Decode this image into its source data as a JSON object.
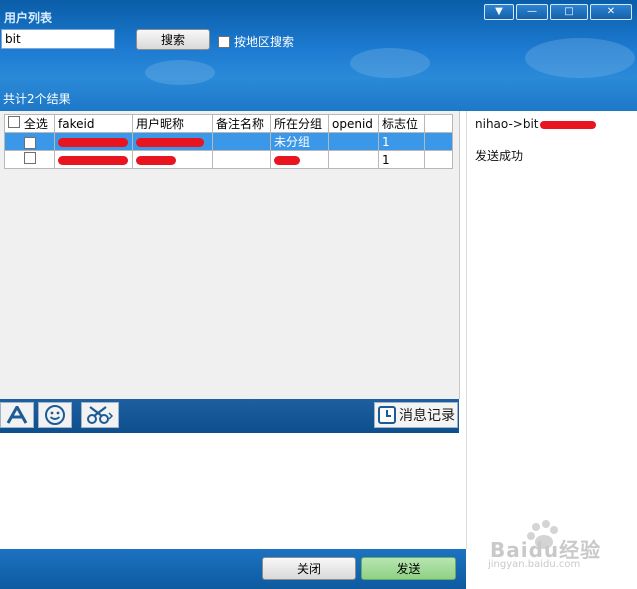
{
  "window": {
    "title": "用户列表",
    "controls": [
      "menu-icon",
      "minimize-icon",
      "maximize-icon",
      "close-icon"
    ]
  },
  "search": {
    "value": "bit",
    "button_label": "搜索",
    "region_label": "按地区搜索",
    "region_checked": false
  },
  "result_count_label": "共计2个结果",
  "table": {
    "columns": [
      "全选",
      "fakeid",
      "用户昵称",
      "备注名称",
      "所在分组",
      "openid",
      "标志位"
    ],
    "rows": [
      {
        "checked": true,
        "fakeid": "",
        "nickname": "",
        "remark": "",
        "group": "未分组",
        "openid": "",
        "flag": "1",
        "selected": true
      },
      {
        "checked": false,
        "fakeid": "",
        "nickname": "",
        "remark": "",
        "group": "",
        "openid": "",
        "flag": "1",
        "selected": false
      }
    ]
  },
  "toolbar": {
    "tools": [
      "font-icon",
      "emoji-icon",
      "scissors-icon"
    ],
    "history_label": "消息记录"
  },
  "log": {
    "line1": "nihao->bit",
    "line2": "发送成功"
  },
  "footer": {
    "close_label": "关闭",
    "send_label": "发送"
  },
  "watermark": {
    "brand": "Baidu经验",
    "url": "jingyan.baidu.com"
  },
  "colors": {
    "header_blue": "#1d7bd1",
    "selected_row": "#3b97e8",
    "send_button": "#9fd89a",
    "redaction": "#e8141f"
  }
}
